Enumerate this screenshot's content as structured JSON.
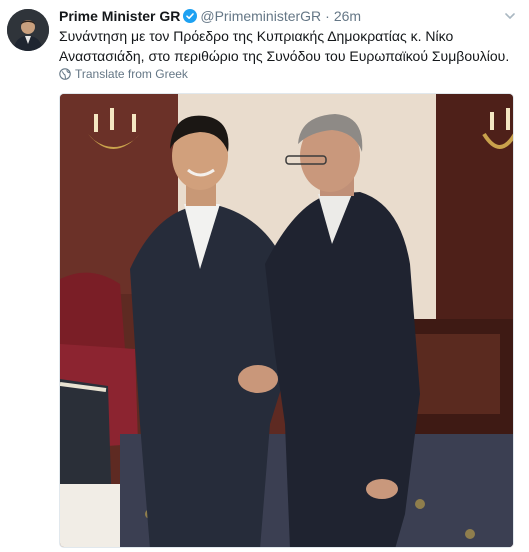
{
  "tweet": {
    "author_name": "Prime Minister GR",
    "handle": "@PrimeministerGR",
    "separator": "·",
    "time": "26m",
    "text_line1": "Συνάντηση με τον Πρόεδρο της Κυπριακής Δημοκρατίας κ. Νίκο",
    "text_line2": "Αναστασιάδη, στο περιθώριο της Συνόδου του Ευρωπαϊκού Συμβουλίου.",
    "translate_label": "Translate from Greek"
  },
  "icons": {
    "verified": "verified-badge-icon",
    "caret": "chevron-down-icon",
    "globe": "globe-icon"
  },
  "colors": {
    "verified": "#1da1f2",
    "secondary_text": "#657786"
  }
}
